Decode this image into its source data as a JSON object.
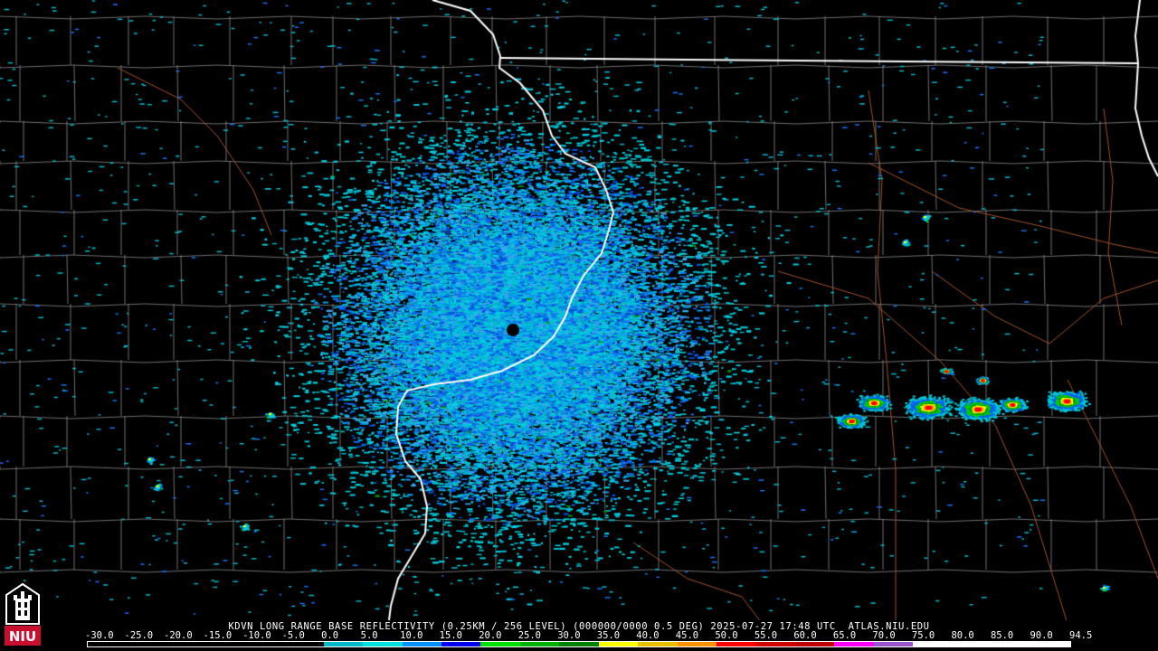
{
  "title": "KDVN LONG RANGE BASE REFLECTIVITY (0.25KM / 256 LEVEL) (000000/0000 0.5 DEG) 2025-07-27 17:48 UTC  ATLAS.NIU.EDU",
  "logo_text": "NIU",
  "colors": {
    "background": "#000000",
    "county_lines": "#8a8a8a",
    "state_lines": "#ffffff",
    "roads": "#a0522d",
    "logo_red": "#c8102e"
  },
  "legend": {
    "ticks": [
      "-30.0",
      "-25.0",
      "-20.0",
      "-15.0",
      "-10.0",
      "-5.0",
      "0.0",
      "5.0",
      "10.0",
      "15.0",
      "20.0",
      "25.0",
      "30.0",
      "35.0",
      "40.0",
      "45.0",
      "50.0",
      "55.0",
      "60.0",
      "65.0",
      "70.0",
      "75.0",
      "80.0",
      "85.0",
      "90.0",
      "94.5"
    ],
    "scale_colors": [
      "#000000",
      "#000000",
      "#000000",
      "#000000",
      "#000000",
      "#000000",
      "#00b8c8",
      "#00e0e0",
      "#0090ff",
      "#0000f0",
      "#00e000",
      "#00b000",
      "#008000",
      "#ffff00",
      "#e8c000",
      "#ff9000",
      "#ff0000",
      "#d00000",
      "#c00000",
      "#ff00ff",
      "#9955cc",
      "#ffffff",
      "#ffffff",
      "#ffffff",
      "#ffffff"
    ]
  }
}
